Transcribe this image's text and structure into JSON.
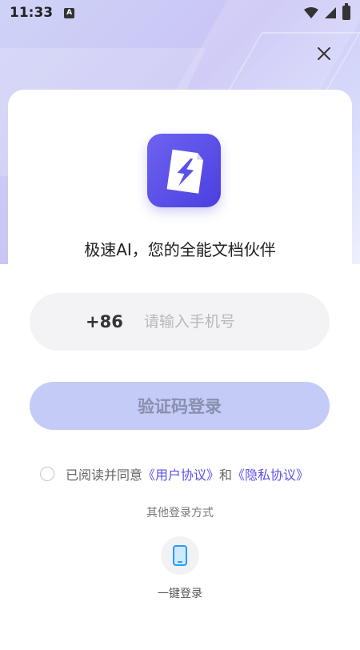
{
  "status_bar": {
    "time": "11:33",
    "notification_icon": "a-icon",
    "wifi_icon": "wifi-icon",
    "signal_icon": "signal-icon",
    "battery_icon": "battery-icon"
  },
  "close_icon": "close-icon",
  "app": {
    "logo_icon": "lightning-document-icon",
    "tagline": "极速AI，您的全能文档伙伴"
  },
  "phone_form": {
    "country_code": "+86",
    "placeholder": "请输入手机号",
    "value": ""
  },
  "login_button": {
    "label": "验证码登录"
  },
  "agreement": {
    "prefix": "已阅读并同意",
    "user_agreement": "《用户协议》",
    "conjunction": "和",
    "privacy_policy": "《隐私协议》",
    "checked": false
  },
  "other_login": {
    "label": "其他登录方式",
    "one_key_icon": "phone-icon",
    "one_key_label": "一键登录"
  },
  "colors": {
    "accent": "#5a50e6",
    "button_disabled": "#c5cbf7",
    "logo": "#5b50e8"
  }
}
